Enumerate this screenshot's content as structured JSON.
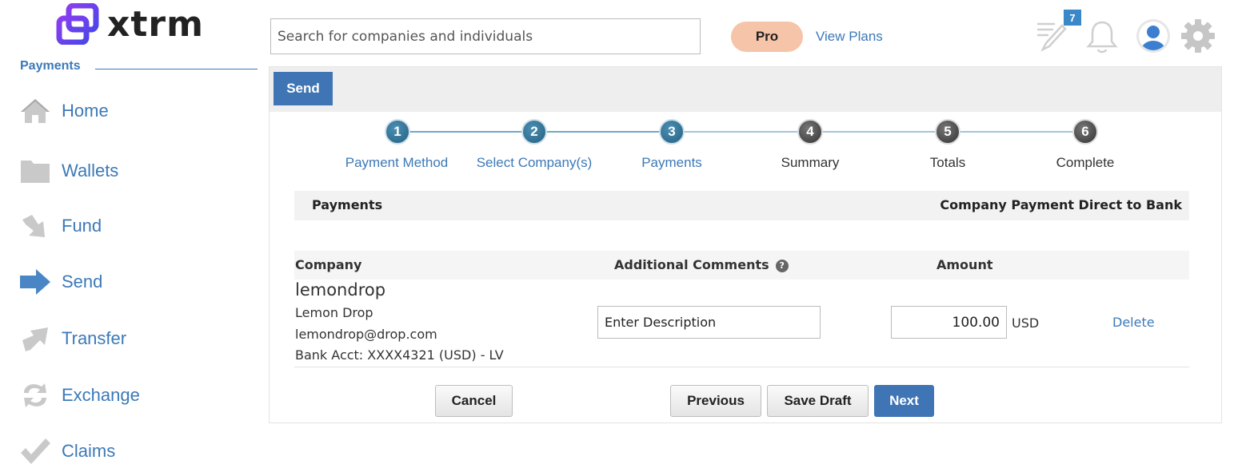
{
  "app": {
    "logo_text": "xtrm"
  },
  "sidebar": {
    "section_title": "Payments",
    "items": [
      {
        "label": "Home",
        "icon": "home-icon"
      },
      {
        "label": "Wallets",
        "icon": "folder-icon"
      },
      {
        "label": "Fund",
        "icon": "fund-arrow-icon"
      },
      {
        "label": "Send",
        "icon": "send-arrow-icon"
      },
      {
        "label": "Transfer",
        "icon": "transfer-arrow-icon"
      },
      {
        "label": "Exchange",
        "icon": "exchange-icon"
      },
      {
        "label": "Claims",
        "icon": "checkmark-icon"
      }
    ]
  },
  "header": {
    "search_placeholder": "Search for companies and individuals",
    "plan_badge": "Pro",
    "view_plans": "View Plans",
    "notes_count": "7"
  },
  "panel": {
    "tab_label": "Send",
    "steps": [
      {
        "number": "1",
        "label": "Payment Method",
        "state": "active"
      },
      {
        "number": "2",
        "label": "Select Company(s)",
        "state": "active"
      },
      {
        "number": "3",
        "label": "Payments",
        "state": "active"
      },
      {
        "number": "4",
        "label": "Summary",
        "state": "todo"
      },
      {
        "number": "5",
        "label": "Totals",
        "state": "todo"
      },
      {
        "number": "6",
        "label": "Complete",
        "state": "todo"
      }
    ],
    "section_title": "Payments",
    "payment_type": "Company Payment Direct to Bank",
    "table": {
      "headers": {
        "company": "Company",
        "comments": "Additional Comments",
        "amount": "Amount"
      },
      "rows": [
        {
          "company_handle": "lemondrop",
          "company_name": "Lemon Drop",
          "email": "lemondrop@drop.com",
          "bank": "Bank Acct: XXXX4321 (USD) - LV",
          "description_placeholder": "Enter Description",
          "amount": "100.00",
          "currency": "USD",
          "delete_label": "Delete"
        }
      ]
    },
    "buttons": {
      "cancel": "Cancel",
      "previous": "Previous",
      "save_draft": "Save Draft",
      "next": "Next"
    }
  },
  "colors": {
    "accent": "#3c79b8",
    "primary_button": "#3f75b4",
    "pro_badge": "#f6c4a8",
    "step_active": "#2f6d8f",
    "step_todo": "#444444"
  }
}
